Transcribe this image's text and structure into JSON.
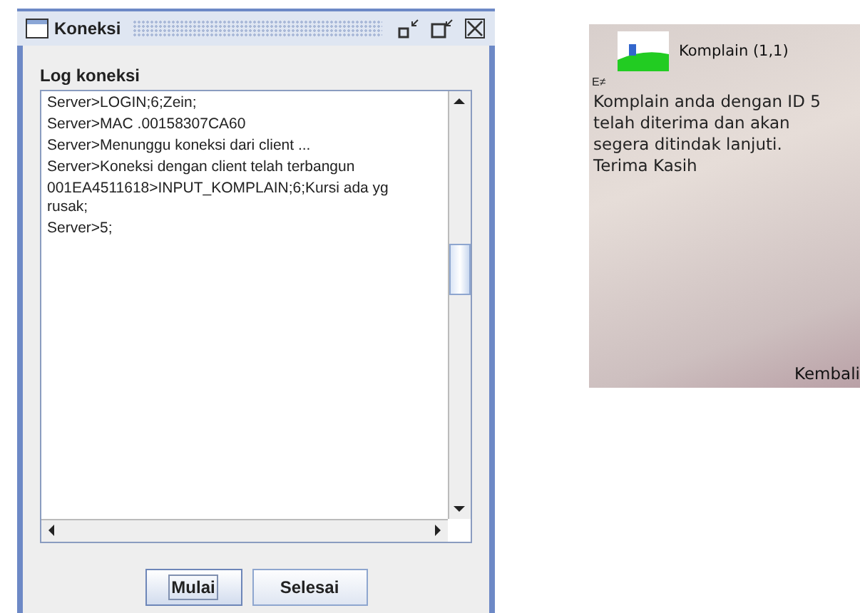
{
  "window": {
    "title": "Koneksi"
  },
  "log": {
    "label": "Log koneksi",
    "lines": [
      "Server>LOGIN;6;Zein;",
      "Server>MAC .00158307CA60",
      "Server>Menunggu koneksi dari client ...",
      "Server>Koneksi dengan client telah terbangun",
      "001EA4511618>INPUT_KOMPLAIN;6;Kursi ada yg rusak;",
      "Server>5;"
    ]
  },
  "buttons": [
    {
      "label": "Mulai",
      "focused": true
    },
    {
      "label": "Selesai",
      "focused": false
    }
  ],
  "phone": {
    "title": "Komplain (1,1)",
    "indicator": "E≠",
    "message": "Komplain anda dengan ID 5 telah diterima dan akan segera ditindak lanjuti. Terima Kasih",
    "softkey": "Kembali"
  }
}
